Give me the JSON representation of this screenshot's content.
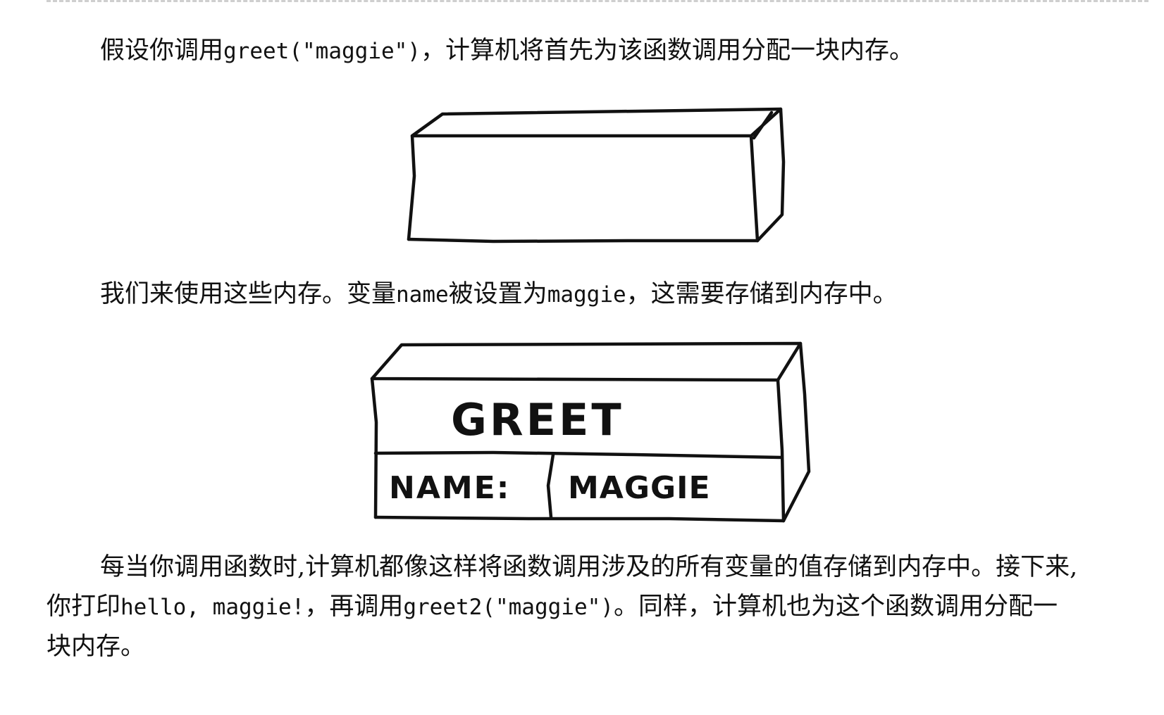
{
  "paragraph1": {
    "text_a": "假设你调用",
    "code_a": "greet(\"maggie\")",
    "text_b": "，计算机将首先为该函数调用分配一块内存。"
  },
  "paragraph2": {
    "text_a": "我们来使用这些内存。变量",
    "code_a": "name",
    "text_b": "被设置为",
    "code_b": "maggie",
    "text_c": "，这需要存储到内存中。"
  },
  "figure2": {
    "function_label": "GREET",
    "var_label": "NAME:",
    "var_value": "MAGGIE"
  },
  "paragraph3": {
    "line1": "每当你调用函数时,计算机都像这样将函数调用涉及的所有变量的值存储到内存中。接下来,",
    "line2_a": "你打印",
    "line2_code_a": "hello, maggie!",
    "line2_b": "，再调用",
    "line2_code_b": "greet2(\"maggie\")",
    "line2_c": "。同样，计算机也为这个函数调用分配一",
    "line3": "块内存。"
  }
}
